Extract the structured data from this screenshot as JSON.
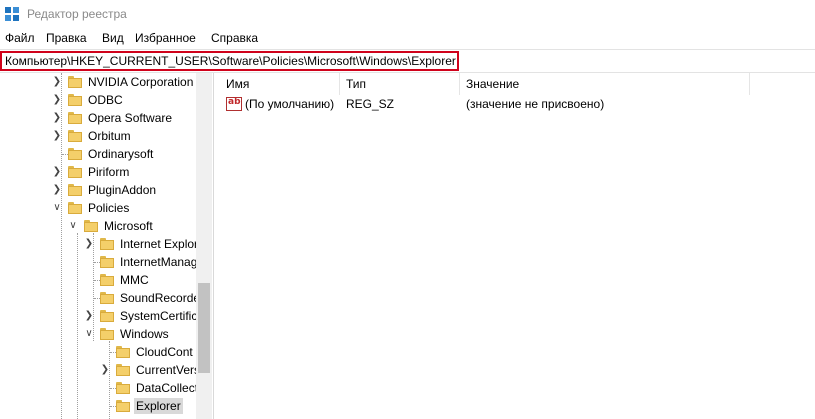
{
  "window": {
    "title": "Редактор реестра"
  },
  "menu": [
    "Файл",
    "Правка",
    "Вид",
    "Избранное",
    "Справка"
  ],
  "address": {
    "path": "Компьютер\\HKEY_CURRENT_USER\\Software\\Policies\\Microsoft\\Windows\\Explorer"
  },
  "tree": {
    "items": [
      {
        "label": "NVIDIA Corporation"
      },
      {
        "label": "ODBC"
      },
      {
        "label": "Opera Software"
      },
      {
        "label": "Orbitum"
      },
      {
        "label": "Ordinarysoft"
      },
      {
        "label": "Piriform"
      },
      {
        "label": "PluginAddon"
      },
      {
        "label": "Policies"
      },
      {
        "label": "Microsoft"
      },
      {
        "label": "Internet Explor"
      },
      {
        "label": "InternetManag"
      },
      {
        "label": "MMC"
      },
      {
        "label": "SoundRecorde"
      },
      {
        "label": "SystemCertific"
      },
      {
        "label": "Windows"
      },
      {
        "label": "CloudCont"
      },
      {
        "label": "CurrentVers"
      },
      {
        "label": "DataCollect"
      },
      {
        "label": "Explorer"
      }
    ]
  },
  "list": {
    "columns": [
      "Имя",
      "Тип",
      "Значение"
    ],
    "rows": [
      {
        "icon": "string-value-icon",
        "icon_text": "ab",
        "name": "(По умолчанию)",
        "type": "REG_SZ",
        "value": "(значение не присвоено)"
      }
    ]
  },
  "colors": {
    "highlight_border": "#d0021b",
    "folder": "#f4cf6a",
    "selection": "#d9d9d9"
  }
}
